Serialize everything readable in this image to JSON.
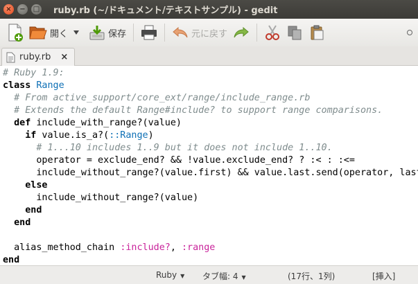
{
  "window": {
    "title": "ruby.rb (~/ドキュメント/テキストサンプル) - gedit",
    "close_glyph": "×",
    "min_glyph": "−",
    "max_glyph": "□"
  },
  "toolbar": {
    "open_label": "開く",
    "save_label": "保存",
    "undo_label": "元に戻す"
  },
  "tab": {
    "label": "ruby.rb",
    "close_glyph": "×"
  },
  "editor": {
    "lines": [
      [
        {
          "t": "# Ruby 1.9:",
          "c": "comment"
        }
      ],
      [
        {
          "t": "class",
          "c": "kw"
        },
        {
          "t": " ",
          "c": "plain"
        },
        {
          "t": "Range",
          "c": "const"
        }
      ],
      [
        {
          "t": "  ",
          "c": "plain"
        },
        {
          "t": "# From active_support/core_ext/range/include_range.rb",
          "c": "comment"
        }
      ],
      [
        {
          "t": "  ",
          "c": "plain"
        },
        {
          "t": "# Extends the default Range#include? to support range comparisons.",
          "c": "comment"
        }
      ],
      [
        {
          "t": "  ",
          "c": "plain"
        },
        {
          "t": "def",
          "c": "kw"
        },
        {
          "t": " include_with_range?(value)",
          "c": "plain"
        }
      ],
      [
        {
          "t": "    ",
          "c": "plain"
        },
        {
          "t": "if",
          "c": "kw"
        },
        {
          "t": " value.is_a?(",
          "c": "plain"
        },
        {
          "t": "::Range",
          "c": "const"
        },
        {
          "t": ")",
          "c": "plain"
        }
      ],
      [
        {
          "t": "      ",
          "c": "plain"
        },
        {
          "t": "# 1...10 includes 1..9 but it does not include 1..10.",
          "c": "comment"
        }
      ],
      [
        {
          "t": "      operator = exclude_end? && !value.exclude_end? ? :< : :<=",
          "c": "plain"
        }
      ],
      [
        {
          "t": "      include_without_range?(value.first) && value.last.send(operator, last)",
          "c": "plain"
        }
      ],
      [
        {
          "t": "    ",
          "c": "plain"
        },
        {
          "t": "else",
          "c": "kw"
        }
      ],
      [
        {
          "t": "      include_without_range?(value)",
          "c": "plain"
        }
      ],
      [
        {
          "t": "    ",
          "c": "plain"
        },
        {
          "t": "end",
          "c": "kw"
        }
      ],
      [
        {
          "t": "  ",
          "c": "plain"
        },
        {
          "t": "end",
          "c": "kw"
        }
      ],
      [
        {
          "t": "",
          "c": "plain"
        }
      ],
      [
        {
          "t": "  alias_method_chain ",
          "c": "plain"
        },
        {
          "t": ":include?",
          "c": "sym"
        },
        {
          "t": ", ",
          "c": "plain"
        },
        {
          "t": ":range",
          "c": "sym"
        }
      ],
      [
        {
          "t": "end",
          "c": "kw"
        }
      ]
    ]
  },
  "statusbar": {
    "language": "Ruby",
    "tab_width": "タブ幅: 4",
    "position": "(17行、1列)",
    "mode": "[挿入]"
  }
}
